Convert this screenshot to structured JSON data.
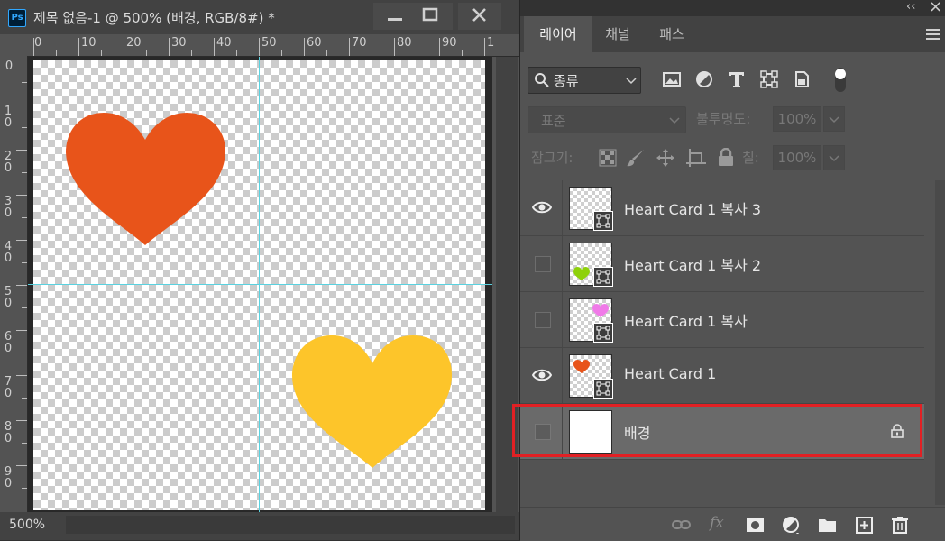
{
  "document": {
    "app_badge": "Ps",
    "title": "제목 없음-1 @ 500% (배경, RGB/8#) *",
    "zoom": "500%",
    "ruler_top_labels": [
      "0",
      "10",
      "20",
      "30",
      "40",
      "50",
      "60",
      "70",
      "80",
      "90",
      "1"
    ],
    "ruler_left_labels": [
      "0",
      "10",
      "20",
      "30",
      "40",
      "50",
      "60",
      "70",
      "80",
      "90"
    ],
    "canvas_shapes": [
      {
        "name": "orange-heart",
        "color": "#e8541a"
      },
      {
        "name": "yellow-heart",
        "color": "#fdc52a"
      }
    ]
  },
  "panel": {
    "collapse_glyph": "‹‹",
    "close_glyph": "×",
    "tabs": [
      {
        "label": "레이어",
        "active": true
      },
      {
        "label": "채널",
        "active": false
      },
      {
        "label": "패스",
        "active": false
      }
    ],
    "filter": {
      "kind_label": "종류",
      "icons": [
        "image-filter-icon",
        "adjustment-filter-icon",
        "type-filter-icon",
        "shape-filter-icon",
        "smart-object-filter-icon",
        "filter-toggle-icon"
      ]
    },
    "blend_mode": "표준",
    "opacity_label": "불투명도:",
    "opacity_value": "100%",
    "lock_label": "잠그기:",
    "fill_label": "칠:",
    "fill_value": "100%",
    "layers": [
      {
        "name": "Heart Card 1 복사 3",
        "visible": true,
        "thumb_heart_color": "",
        "smart": true,
        "selected": false,
        "locked": false
      },
      {
        "name": "Heart Card 1 복사 2",
        "visible": false,
        "thumb_heart_color": "#8ed10a",
        "smart": true,
        "selected": false,
        "locked": false
      },
      {
        "name": "Heart Card 1 복사",
        "visible": false,
        "thumb_heart_color": "#f07ae8",
        "smart": true,
        "selected": false,
        "locked": false
      },
      {
        "name": "Heart Card 1",
        "visible": true,
        "thumb_heart_color": "#e8541a",
        "smart": true,
        "selected": false,
        "locked": false
      },
      {
        "name": "배경",
        "visible": false,
        "thumb_heart_color": "",
        "smart": false,
        "selected": true,
        "locked": true
      }
    ],
    "highlight_color": "#e22024",
    "bottom_icons": [
      "link-layers-icon",
      "fx-icon",
      "layer-mask-icon",
      "adjustment-layer-icon",
      "group-folder-icon",
      "new-layer-icon",
      "delete-layer-icon"
    ],
    "fx_label": "fx"
  }
}
